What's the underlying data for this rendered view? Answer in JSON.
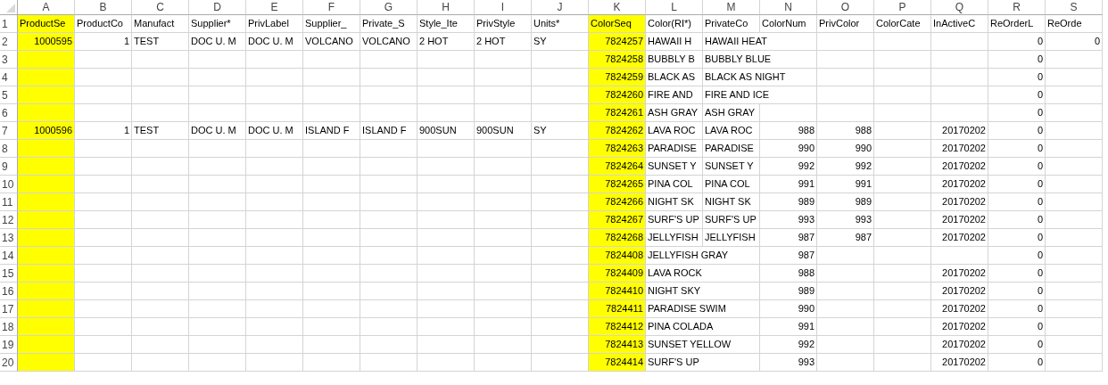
{
  "columns": [
    {
      "letter": "A",
      "highlighted": true
    },
    {
      "letter": "B",
      "highlighted": false
    },
    {
      "letter": "C",
      "highlighted": false
    },
    {
      "letter": "D",
      "highlighted": false
    },
    {
      "letter": "E",
      "highlighted": false
    },
    {
      "letter": "F",
      "highlighted": false
    },
    {
      "letter": "G",
      "highlighted": false
    },
    {
      "letter": "H",
      "highlighted": false
    },
    {
      "letter": "I",
      "highlighted": false
    },
    {
      "letter": "J",
      "highlighted": false
    },
    {
      "letter": "K",
      "highlighted": true
    },
    {
      "letter": "L",
      "highlighted": false
    },
    {
      "letter": "M",
      "highlighted": false
    },
    {
      "letter": "N",
      "highlighted": false
    },
    {
      "letter": "O",
      "highlighted": false
    },
    {
      "letter": "P",
      "highlighted": false
    },
    {
      "letter": "Q",
      "highlighted": false
    },
    {
      "letter": "R",
      "highlighted": false
    },
    {
      "letter": "S",
      "highlighted": false
    }
  ],
  "rows": [
    {
      "number": "1",
      "cells": {
        "A": {
          "text": "ProductSe",
          "kind": "text"
        },
        "B": {
          "text": "ProductCo",
          "kind": "text"
        },
        "C": {
          "text": "Manufact",
          "kind": "text"
        },
        "D": {
          "text": "Supplier*",
          "kind": "text"
        },
        "E": {
          "text": "PrivLabel",
          "kind": "text"
        },
        "F": {
          "text": "Supplier_",
          "kind": "text"
        },
        "G": {
          "text": "Private_S",
          "kind": "text"
        },
        "H": {
          "text": "Style_Ite",
          "kind": "text"
        },
        "I": {
          "text": "PrivStyle",
          "kind": "text"
        },
        "J": {
          "text": "Units*",
          "kind": "text"
        },
        "K": {
          "text": "ColorSeq",
          "kind": "text"
        },
        "L": {
          "text": "Color(RI*)",
          "kind": "text"
        },
        "M": {
          "text": "PrivateCo",
          "kind": "text"
        },
        "N": {
          "text": "ColorNum",
          "kind": "text"
        },
        "O": {
          "text": "PrivColor",
          "kind": "text"
        },
        "P": {
          "text": "ColorCate",
          "kind": "text"
        },
        "Q": {
          "text": "InActiveC",
          "kind": "text"
        },
        "R": {
          "text": "ReOrderL",
          "kind": "text"
        },
        "S": {
          "text": "ReOrde",
          "kind": "text"
        }
      }
    },
    {
      "number": "2",
      "cells": {
        "A": {
          "text": "1000595",
          "kind": "number"
        },
        "B": {
          "text": "1",
          "kind": "number"
        },
        "C": {
          "text": "TEST",
          "kind": "text"
        },
        "D": {
          "text": "DOC U. M",
          "kind": "text"
        },
        "E": {
          "text": "DOC U. M",
          "kind": "text"
        },
        "F": {
          "text": "VOLCANO",
          "kind": "text"
        },
        "G": {
          "text": "VOLCANO",
          "kind": "text"
        },
        "H": {
          "text": "2 HOT",
          "kind": "text"
        },
        "I": {
          "text": "2 HOT",
          "kind": "text"
        },
        "J": {
          "text": "SY",
          "kind": "text"
        },
        "K": {
          "text": "7824257",
          "kind": "number"
        },
        "L": {
          "text": "HAWAII H",
          "kind": "text"
        },
        "M": {
          "text": "HAWAII HEAT",
          "kind": "text"
        },
        "R": {
          "text": "0",
          "kind": "number"
        },
        "S": {
          "text": "0",
          "kind": "number"
        }
      }
    },
    {
      "number": "3",
      "cells": {
        "K": {
          "text": "7824258",
          "kind": "number"
        },
        "L": {
          "text": "BUBBLY B",
          "kind": "text"
        },
        "M": {
          "text": "BUBBLY BLUE",
          "kind": "text"
        },
        "R": {
          "text": "0",
          "kind": "number"
        }
      }
    },
    {
      "number": "4",
      "cells": {
        "K": {
          "text": "7824259",
          "kind": "number"
        },
        "L": {
          "text": "BLACK AS",
          "kind": "text"
        },
        "M": {
          "text": "BLACK AS NIGHT",
          "kind": "text"
        },
        "R": {
          "text": "0",
          "kind": "number"
        }
      }
    },
    {
      "number": "5",
      "cells": {
        "K": {
          "text": "7824260",
          "kind": "number"
        },
        "L": {
          "text": "FIRE AND",
          "kind": "text"
        },
        "M": {
          "text": "FIRE AND ICE",
          "kind": "text"
        },
        "R": {
          "text": "0",
          "kind": "number"
        }
      }
    },
    {
      "number": "6",
      "cells": {
        "K": {
          "text": "7824261",
          "kind": "number"
        },
        "L": {
          "text": "ASH GRAY",
          "kind": "text"
        },
        "M": {
          "text": "ASH GRAY",
          "kind": "text"
        },
        "R": {
          "text": "0",
          "kind": "number"
        }
      }
    },
    {
      "number": "7",
      "cells": {
        "A": {
          "text": "1000596",
          "kind": "number"
        },
        "B": {
          "text": "1",
          "kind": "number"
        },
        "C": {
          "text": "TEST",
          "kind": "text"
        },
        "D": {
          "text": "DOC U. M",
          "kind": "text"
        },
        "E": {
          "text": "DOC U. M",
          "kind": "text"
        },
        "F": {
          "text": "ISLAND F",
          "kind": "text"
        },
        "G": {
          "text": "ISLAND F",
          "kind": "text"
        },
        "H": {
          "text": "900SUN",
          "kind": "text"
        },
        "I": {
          "text": "900SUN",
          "kind": "text"
        },
        "J": {
          "text": "SY",
          "kind": "text"
        },
        "K": {
          "text": "7824262",
          "kind": "number"
        },
        "L": {
          "text": "LAVA ROC",
          "kind": "text"
        },
        "M": {
          "text": "LAVA ROC",
          "kind": "text"
        },
        "N": {
          "text": "988",
          "kind": "number"
        },
        "O": {
          "text": "988",
          "kind": "number"
        },
        "Q": {
          "text": "20170202",
          "kind": "number"
        },
        "R": {
          "text": "0",
          "kind": "number"
        }
      }
    },
    {
      "number": "8",
      "cells": {
        "K": {
          "text": "7824263",
          "kind": "number"
        },
        "L": {
          "text": "PARADISE",
          "kind": "text"
        },
        "M": {
          "text": "PARADISE",
          "kind": "text"
        },
        "N": {
          "text": "990",
          "kind": "number"
        },
        "O": {
          "text": "990",
          "kind": "number"
        },
        "Q": {
          "text": "20170202",
          "kind": "number"
        },
        "R": {
          "text": "0",
          "kind": "number"
        }
      }
    },
    {
      "number": "9",
      "cells": {
        "K": {
          "text": "7824264",
          "kind": "number"
        },
        "L": {
          "text": "SUNSET Y",
          "kind": "text"
        },
        "M": {
          "text": "SUNSET Y",
          "kind": "text"
        },
        "N": {
          "text": "992",
          "kind": "number"
        },
        "O": {
          "text": "992",
          "kind": "number"
        },
        "Q": {
          "text": "20170202",
          "kind": "number"
        },
        "R": {
          "text": "0",
          "kind": "number"
        }
      }
    },
    {
      "number": "10",
      "cells": {
        "K": {
          "text": "7824265",
          "kind": "number"
        },
        "L": {
          "text": "PINA COL",
          "kind": "text"
        },
        "M": {
          "text": "PINA COL",
          "kind": "text"
        },
        "N": {
          "text": "991",
          "kind": "number"
        },
        "O": {
          "text": "991",
          "kind": "number"
        },
        "Q": {
          "text": "20170202",
          "kind": "number"
        },
        "R": {
          "text": "0",
          "kind": "number"
        }
      }
    },
    {
      "number": "11",
      "cells": {
        "K": {
          "text": "7824266",
          "kind": "number"
        },
        "L": {
          "text": "NIGHT SK",
          "kind": "text"
        },
        "M": {
          "text": "NIGHT SK",
          "kind": "text"
        },
        "N": {
          "text": "989",
          "kind": "number"
        },
        "O": {
          "text": "989",
          "kind": "number"
        },
        "Q": {
          "text": "20170202",
          "kind": "number"
        },
        "R": {
          "text": "0",
          "kind": "number"
        }
      }
    },
    {
      "number": "12",
      "cells": {
        "K": {
          "text": "7824267",
          "kind": "number"
        },
        "L": {
          "text": "SURF'S UP",
          "kind": "text"
        },
        "M": {
          "text": "SURF'S UP",
          "kind": "text"
        },
        "N": {
          "text": "993",
          "kind": "number"
        },
        "O": {
          "text": "993",
          "kind": "number"
        },
        "Q": {
          "text": "20170202",
          "kind": "number"
        },
        "R": {
          "text": "0",
          "kind": "number"
        }
      }
    },
    {
      "number": "13",
      "cells": {
        "K": {
          "text": "7824268",
          "kind": "number"
        },
        "L": {
          "text": "JELLYFISH",
          "kind": "text"
        },
        "M": {
          "text": "JELLYFISH",
          "kind": "text"
        },
        "N": {
          "text": "987",
          "kind": "number"
        },
        "O": {
          "text": "987",
          "kind": "number"
        },
        "Q": {
          "text": "20170202",
          "kind": "number"
        },
        "R": {
          "text": "0",
          "kind": "number"
        }
      }
    },
    {
      "number": "14",
      "cells": {
        "K": {
          "text": "7824408",
          "kind": "number"
        },
        "L": {
          "text": "JELLYFISH GRAY",
          "kind": "text"
        },
        "N": {
          "text": "987",
          "kind": "number"
        },
        "R": {
          "text": "0",
          "kind": "number"
        }
      }
    },
    {
      "number": "15",
      "cells": {
        "K": {
          "text": "7824409",
          "kind": "number"
        },
        "L": {
          "text": "LAVA ROCK",
          "kind": "text"
        },
        "N": {
          "text": "988",
          "kind": "number"
        },
        "Q": {
          "text": "20170202",
          "kind": "number"
        },
        "R": {
          "text": "0",
          "kind": "number"
        }
      }
    },
    {
      "number": "16",
      "cells": {
        "K": {
          "text": "7824410",
          "kind": "number"
        },
        "L": {
          "text": "NIGHT SKY",
          "kind": "text"
        },
        "N": {
          "text": "989",
          "kind": "number"
        },
        "Q": {
          "text": "20170202",
          "kind": "number"
        },
        "R": {
          "text": "0",
          "kind": "number"
        }
      }
    },
    {
      "number": "17",
      "cells": {
        "K": {
          "text": "7824411",
          "kind": "number"
        },
        "L": {
          "text": "PARADISE SWIM",
          "kind": "text"
        },
        "N": {
          "text": "990",
          "kind": "number"
        },
        "Q": {
          "text": "20170202",
          "kind": "number"
        },
        "R": {
          "text": "0",
          "kind": "number"
        }
      }
    },
    {
      "number": "18",
      "cells": {
        "K": {
          "text": "7824412",
          "kind": "number"
        },
        "L": {
          "text": "PINA COLADA",
          "kind": "text"
        },
        "N": {
          "text": "991",
          "kind": "number"
        },
        "Q": {
          "text": "20170202",
          "kind": "number"
        },
        "R": {
          "text": "0",
          "kind": "number"
        }
      }
    },
    {
      "number": "19",
      "cells": {
        "K": {
          "text": "7824413",
          "kind": "number"
        },
        "L": {
          "text": "SUNSET YELLOW",
          "kind": "text"
        },
        "N": {
          "text": "992",
          "kind": "number"
        },
        "Q": {
          "text": "20170202",
          "kind": "number"
        },
        "R": {
          "text": "0",
          "kind": "number"
        }
      }
    },
    {
      "number": "20",
      "cells": {
        "K": {
          "text": "7824414",
          "kind": "number"
        },
        "L": {
          "text": "SURF'S UP",
          "kind": "text"
        },
        "N": {
          "text": "993",
          "kind": "number"
        },
        "Q": {
          "text": "20170202",
          "kind": "number"
        },
        "R": {
          "text": "0",
          "kind": "number"
        }
      }
    }
  ]
}
